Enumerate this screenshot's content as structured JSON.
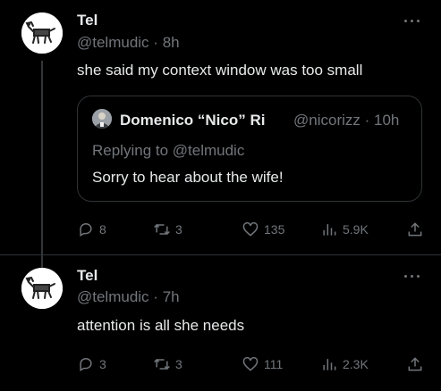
{
  "tweets": [
    {
      "name": "Tel",
      "handle": "@telmudic",
      "time": "8h",
      "text": "she said my context window was too small",
      "quote": {
        "name": "Domenico “Nico” Ri",
        "handle": "@nicorizz",
        "time": "10h",
        "replying_to": "Replying to @telmudic",
        "text": "Sorry to hear about the wife!"
      },
      "stats": {
        "replies": "8",
        "retweets": "3",
        "likes": "135",
        "views": "5.9K"
      }
    },
    {
      "name": "Tel",
      "handle": "@telmudic",
      "time": "7h",
      "text": "attention is all she needs",
      "stats": {
        "replies": "3",
        "retweets": "3",
        "likes": "111",
        "views": "2.3K"
      }
    }
  ],
  "icons": {
    "reply": "speech-bubble-icon",
    "retweet": "retweet-icon",
    "like": "heart-icon",
    "views": "bar-chart-icon",
    "share": "share-upload-icon",
    "more": "more-dots-icon"
  },
  "colors": {
    "background": "#000000",
    "text_primary": "#e7e9ea",
    "text_secondary": "#71767b",
    "border": "#2f3336"
  }
}
